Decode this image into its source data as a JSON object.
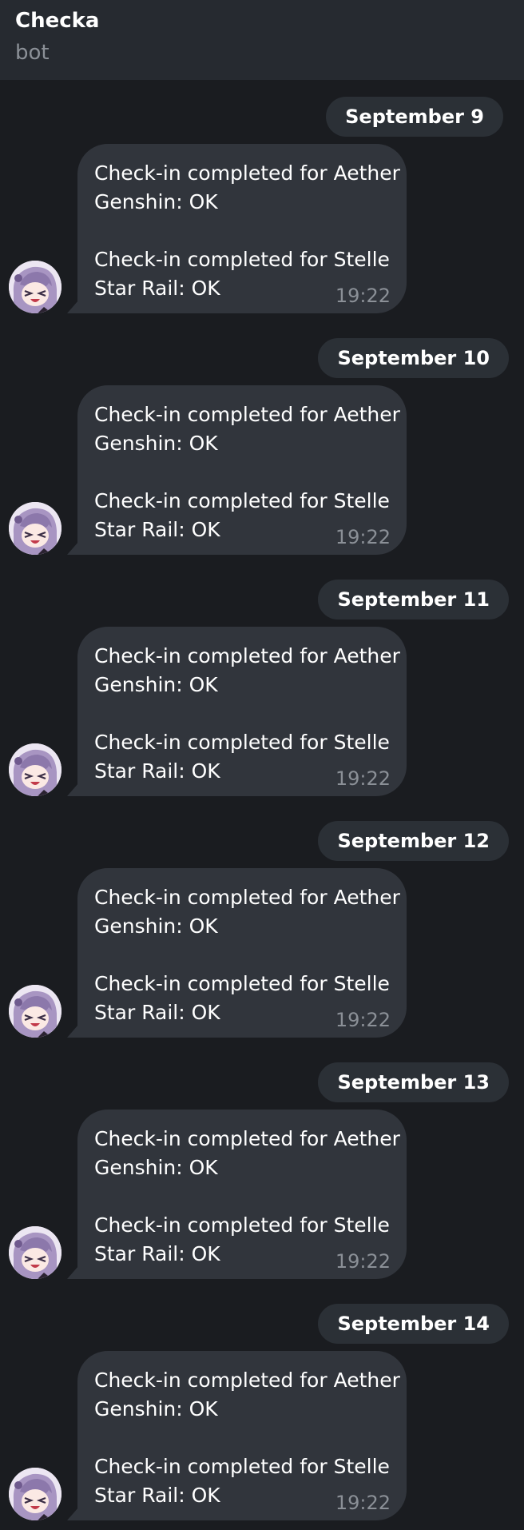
{
  "header": {
    "title": "Checka",
    "subtitle": "bot"
  },
  "colors": {
    "background": "#1a1c20",
    "header": "#262a30",
    "bubble": "#31353c",
    "date_pill": "#2b3036",
    "muted_text": "#8b9097"
  },
  "days": [
    {
      "date": "September 9",
      "message": {
        "line1": "Check-in completed for Aether",
        "line2": "Genshin: OK",
        "line3": "Check-in completed for Stelle",
        "line4": "Star Rail: OK",
        "time": "19:22"
      },
      "avatar_icon": "bot-avatar-anime-icon"
    },
    {
      "date": "September 10",
      "message": {
        "line1": "Check-in completed for Aether",
        "line2": "Genshin: OK",
        "line3": "Check-in completed for Stelle",
        "line4": "Star Rail: OK",
        "time": "19:22"
      },
      "avatar_icon": "bot-avatar-anime-icon"
    },
    {
      "date": "September 11",
      "message": {
        "line1": "Check-in completed for Aether",
        "line2": "Genshin: OK",
        "line3": "Check-in completed for Stelle",
        "line4": "Star Rail: OK",
        "time": "19:22"
      },
      "avatar_icon": "bot-avatar-anime-icon"
    },
    {
      "date": "September 12",
      "message": {
        "line1": "Check-in completed for Aether",
        "line2": "Genshin: OK",
        "line3": "Check-in completed for Stelle",
        "line4": "Star Rail: OK",
        "time": "19:22"
      },
      "avatar_icon": "bot-avatar-anime-icon"
    },
    {
      "date": "September 13",
      "message": {
        "line1": "Check-in completed for Aether",
        "line2": "Genshin: OK",
        "line3": "Check-in completed for Stelle",
        "line4": "Star Rail: OK",
        "time": "19:22"
      },
      "avatar_icon": "bot-avatar-anime-icon"
    },
    {
      "date": "September 14",
      "message": {
        "line1": "Check-in completed for Aether",
        "line2": "Genshin: OK",
        "line3": "Check-in completed for Stelle",
        "line4": "Star Rail: OK",
        "time": "19:22"
      },
      "avatar_icon": "bot-avatar-anime-icon"
    }
  ]
}
